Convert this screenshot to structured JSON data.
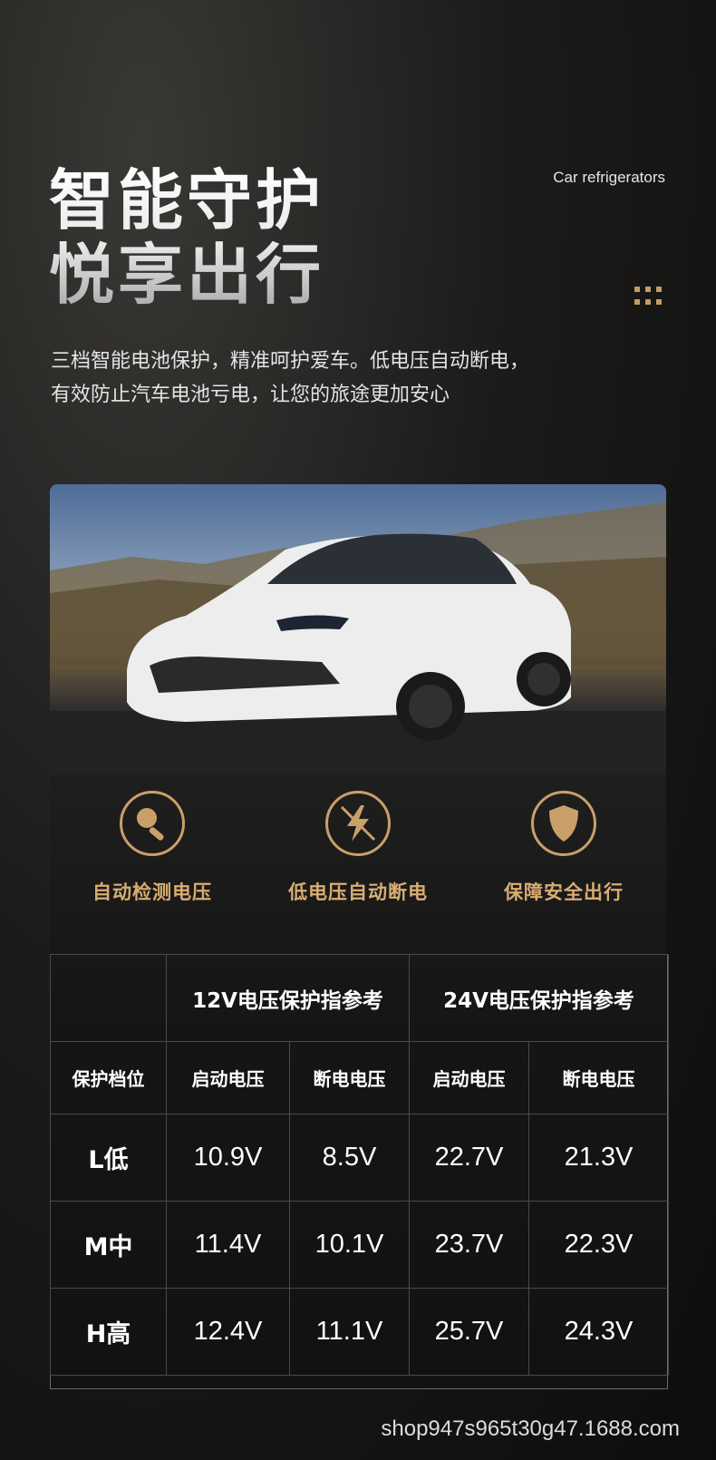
{
  "hero": {
    "title_line1": "智能守护",
    "title_line2": "悦享出行",
    "eyebrow": "Car refrigerators",
    "desc_line1": "三档智能电池保护，精准呵护爱车。低电压自动断电，",
    "desc_line2": "有效防止汽车电池亏电，让您的旅途更加安心"
  },
  "features": [
    {
      "icon": "magnifier-icon",
      "label": "自动检测电压"
    },
    {
      "icon": "lightning-off-icon",
      "label": "低电压自动断电"
    },
    {
      "icon": "shield-icon",
      "label": "保障安全出行"
    }
  ],
  "table": {
    "group_12v": "12V电压保护指参考",
    "group_24v": "24V电压保护指参考",
    "col_level": "保护档位",
    "col_start": "启动电压",
    "col_cutoff": "断电电压",
    "rows": [
      {
        "level": "L低",
        "v12_start": "10.9V",
        "v12_cut": "8.5V",
        "v24_start": "22.7V",
        "v24_cut": "21.3V"
      },
      {
        "level": "M中",
        "v12_start": "11.4V",
        "v12_cut": "10.1V",
        "v24_start": "23.7V",
        "v24_cut": "22.3V"
      },
      {
        "level": "H高",
        "v12_start": "12.4V",
        "v12_cut": "11.1V",
        "v24_start": "25.7V",
        "v24_cut": "24.3V"
      }
    ]
  },
  "footer": "shop947s965t30g47.1688.com",
  "colors": {
    "accent_gold": "#c9a06a",
    "label_gold": "#d9ad72",
    "background": "#1c1b1a"
  }
}
